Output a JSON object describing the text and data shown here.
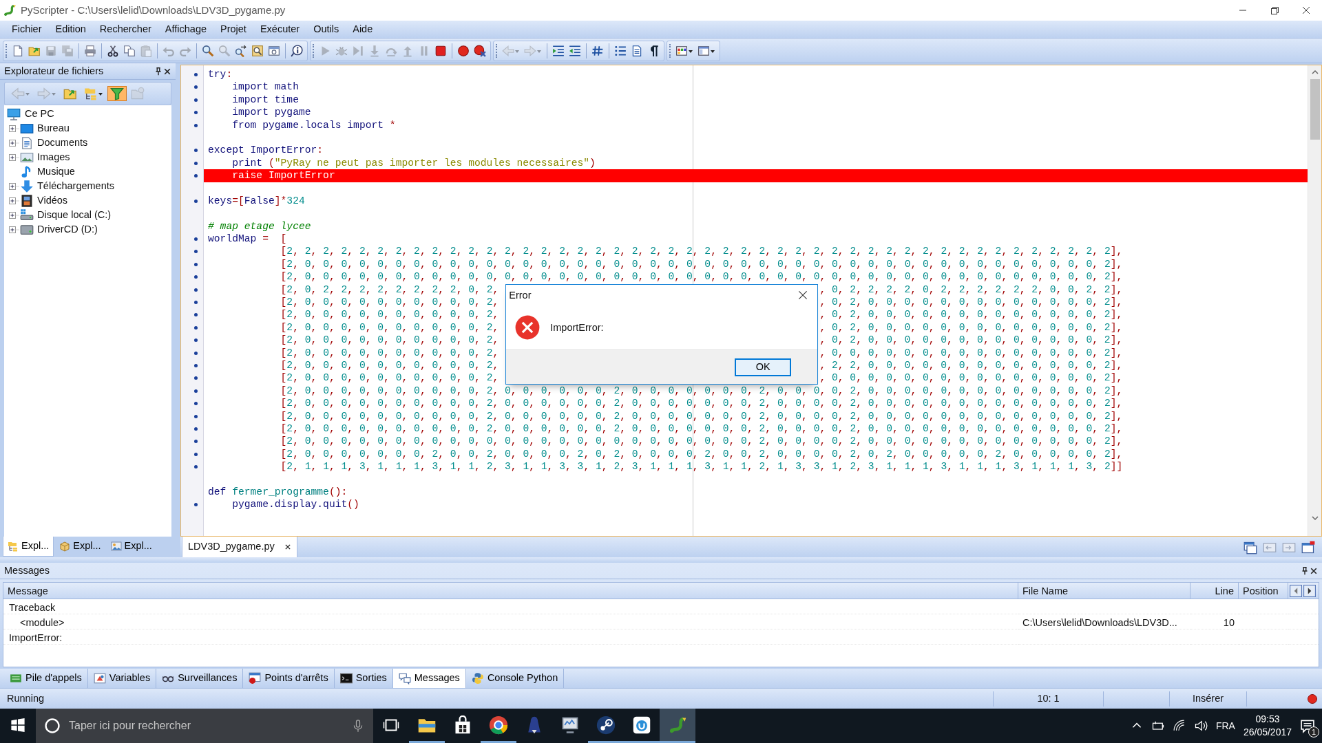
{
  "window": {
    "title": "PyScripter - C:\\Users\\lelid\\Downloads\\LDV3D_pygame.py"
  },
  "menu": [
    "Fichier",
    "Edition",
    "Rechercher",
    "Affichage",
    "Projet",
    "Exécuter",
    "Outils",
    "Aide"
  ],
  "toolbar_groups": [
    [
      {
        "disabled": false
      },
      {
        "disabled": false
      },
      {
        "disabled": true
      },
      {
        "disabled": true
      }
    ],
    [
      {
        "disabled": false
      }
    ],
    [
      {
        "disabled": false
      },
      {
        "disabled": false
      },
      {
        "disabled": true
      }
    ],
    [
      {
        "disabled": true
      },
      {
        "disabled": true
      }
    ],
    [
      {
        "disabled": false
      },
      {
        "disabled": true
      },
      {
        "disabled": false
      },
      {
        "disabled": false
      },
      {
        "disabled": false
      }
    ],
    [
      {
        "disabled": false
      }
    ],
    [
      {
        "disabled": true
      },
      {
        "disabled": true
      },
      {
        "disabled": true
      },
      {
        "disabled": true
      },
      {
        "disabled": true
      },
      {
        "disabled": true
      },
      {
        "disabled": true
      },
      {
        "disabled": false
      }
    ],
    [
      {
        "disabled": false
      },
      {
        "disabled": false
      }
    ],
    [
      {
        "disabled": true
      },
      {
        "disabled": true
      }
    ],
    [
      {
        "disabled": false
      },
      {
        "disabled": false
      }
    ],
    [
      {
        "disabled": false
      }
    ],
    [
      {
        "disabled": false
      },
      {
        "disabled": false
      },
      {
        "disabled": false
      }
    ],
    [
      {
        "disabled": false
      },
      {
        "disabled": false
      }
    ]
  ],
  "file_explorer": {
    "title": "Explorateur de fichiers",
    "toolbar": [
      {
        "disabled": true,
        "on": false
      },
      {
        "disabled": true,
        "on": false
      },
      {
        "disabled": false,
        "on": false
      },
      {
        "disabled": false,
        "on": false
      },
      {
        "disabled": false,
        "on": true
      },
      {
        "disabled": true,
        "on": false
      }
    ],
    "tree": {
      "label": "Ce PC",
      "children": [
        {
          "label": "Bureau",
          "expandable": true
        },
        {
          "label": "Documents",
          "expandable": true
        },
        {
          "label": "Images",
          "expandable": true
        },
        {
          "label": "Musique",
          "expandable": false
        },
        {
          "label": "Téléchargements",
          "expandable": true
        },
        {
          "label": "Vidéos",
          "expandable": true
        },
        {
          "label": "Disque local (C:)",
          "expandable": true
        },
        {
          "label": "DriverCD (D:)",
          "expandable": true
        }
      ]
    },
    "tabs": [
      {
        "label": "Expl...",
        "selected": true
      },
      {
        "label": "Expl...",
        "selected": false
      },
      {
        "label": "Expl...",
        "selected": false
      }
    ]
  },
  "editor": {
    "tabs": [
      {
        "label": "LDV3D_pygame.py",
        "selected": true
      }
    ],
    "lines": [
      {
        "dot": true,
        "tokens": [
          {
            "kind": "id",
            "text": "try"
          },
          {
            "kind": "p",
            "text": ":"
          }
        ]
      },
      {
        "dot": true,
        "tokens": [
          {
            "kind": "id",
            "text": "    import math"
          }
        ]
      },
      {
        "dot": true,
        "tokens": [
          {
            "kind": "id",
            "text": "    import time"
          }
        ]
      },
      {
        "dot": true,
        "tokens": [
          {
            "kind": "id",
            "text": "    import pygame"
          }
        ]
      },
      {
        "dot": true,
        "tokens": [
          {
            "kind": "id",
            "text": "    from pygame.locals import "
          },
          {
            "kind": "p",
            "text": "*"
          }
        ]
      },
      {
        "dot": true,
        "gap_before": true,
        "tokens": [
          {
            "kind": "id",
            "text": "except ImportError"
          },
          {
            "kind": "p",
            "text": ":"
          }
        ]
      },
      {
        "dot": true,
        "tokens": [
          {
            "kind": "id",
            "text": "    print "
          },
          {
            "kind": "p",
            "text": "("
          },
          {
            "kind": "s",
            "text": "\"PyRay ne peut pas importer les modules necessaires\""
          },
          {
            "kind": "p",
            "text": ")"
          }
        ]
      },
      {
        "dot": true,
        "highlighted": true,
        "tokens": [
          {
            "kind": "id",
            "text": "    raise ImportError"
          }
        ]
      },
      {
        "dot": true,
        "gap_before": true,
        "tokens": [
          {
            "kind": "id",
            "text": "keys"
          },
          {
            "kind": "p",
            "text": "=["
          },
          {
            "kind": "id",
            "text": "False"
          },
          {
            "kind": "p",
            "text": "]*"
          },
          {
            "kind": "n",
            "text": "324"
          }
        ]
      },
      {
        "dot": false,
        "gap_before": true,
        "tokens": [
          {
            "kind": "c",
            "text": "# map etage lycee"
          }
        ]
      },
      {
        "dot": true,
        "tokens": [
          {
            "kind": "id",
            "text": "worldMap "
          },
          {
            "kind": "p",
            "text": "=  ["
          }
        ]
      },
      {
        "dot": true,
        "text": "            [2, 2, 2, 2, 2, 2, 2, 2, 2, 2, 2, 2, 2, 2, 2, 2, 2, 2, 2, 2, 2, 2, 2, 2, 2, 2, 2, 2, 2, 2, 2, 2, 2, 2, 2, 2, 2, 2, 2, 2, 2, 2, 2, 2, 2, 2],"
      },
      {
        "dot": true,
        "text": "            [2, 0, 0, 0, 0, 0, 0, 0, 0, 0, 0, 0, 0, 0, 0, 0, 0, 0, 0, 0, 0, 0, 0, 0, 0, 0, 0, 0, 0, 0, 0, 0, 0, 0, 0, 0, 0, 0, 0, 0, 0, 0, 0, 0, 0, 2],"
      },
      {
        "dot": true,
        "text": "            [2, 0, 0, 0, 0, 0, 0, 0, 0, 0, 0, 0, 0, 0, 0, 0, 0, 0, 0, 0, 0, 0, 0, 0, 0, 0, 0, 0, 0, 0, 0, 0, 0, 0, 0, 0, 0, 0, 0, 0, 0, 0, 0, 0, 0, 2],"
      },
      {
        "dot": true,
        "left": "            [2, 0, 2, 2, 2, 2, 2, 2, 2, 2, 0, 2,",
        "right": ", 0, 2, 2, 2, 2, 0, 2, 2, 2, 2, 2, 2, 0, 0, 2, 2],"
      },
      {
        "dot": true,
        "left": "            [2, 0, 0, 0, 0, 0, 0, 0, 0, 0, 0, 2,",
        "right": ", 0, 2, 0, 0, 0, 0, 0, 0, 0, 0, 0, 0, 0, 0, 0, 2],"
      },
      {
        "dot": true,
        "left": "            [2, 0, 0, 0, 0, 0, 0, 0, 0, 0, 0, 2,",
        "right": ", 0, 2, 0, 0, 0, 0, 0, 0, 0, 0, 0, 0, 0, 0, 0, 2],"
      },
      {
        "dot": true,
        "left": "            [2, 0, 0, 0, 0, 0, 0, 0, 0, 0, 0, 2,",
        "right": ", 0, 2, 0, 0, 0, 0, 0, 0, 0, 0, 0, 0, 0, 0, 0, 2],"
      },
      {
        "dot": true,
        "left": "            [2, 0, 0, 0, 0, 0, 0, 0, 0, 0, 0, 2,",
        "right": ", 0, 2, 0, 0, 0, 0, 0, 0, 0, 0, 0, 0, 0, 0, 0, 2],"
      },
      {
        "dot": true,
        "left": "            [2, 0, 0, 0, 0, 0, 0, 0, 0, 0, 0, 2,",
        "right": ", 0, 0, 0, 0, 0, 0, 0, 0, 0, 0, 0, 0, 0, 0, 0, 2],"
      },
      {
        "dot": true,
        "left": "            [2, 0, 0, 0, 0, 0, 0, 0, 0, 0, 0, 2,",
        "right": ", 2, 2, 0, 0, 0, 0, 0, 0, 0, 0, 0, 0, 0, 0, 0, 2],"
      },
      {
        "dot": true,
        "left": "            [2, 0, 0, 0, 0, 0, 0, 0, 0, 0, 0, 2,",
        "right": ", 0, 0, 0, 0, 0, 0, 0, 0, 0, 0, 0, 0, 0, 0, 0, 2],"
      },
      {
        "dot": true,
        "text": "            [2, 0, 0, 0, 0, 0, 0, 0, 0, 0, 0, 2, 0, 0, 0, 0, 0, 0, 2, 0, 0, 0, 0, 0, 0, 0, 2, 0, 0, 0, 0, 2, 0, 0, 0, 0, 0, 0, 0, 0, 0, 0, 0, 0, 0, 2],"
      },
      {
        "dot": true,
        "text": "            [2, 0, 0, 0, 0, 0, 0, 0, 0, 0, 0, 2, 0, 0, 0, 0, 0, 0, 2, 0, 0, 0, 0, 0, 0, 0, 2, 0, 0, 0, 0, 2, 0, 0, 0, 0, 0, 0, 0, 0, 0, 0, 0, 0, 0, 2],"
      },
      {
        "dot": true,
        "text": "            [2, 0, 0, 0, 0, 0, 0, 0, 0, 0, 0, 2, 0, 0, 0, 0, 0, 0, 2, 0, 0, 0, 0, 0, 0, 0, 2, 0, 0, 0, 0, 2, 0, 0, 0, 0, 0, 0, 0, 0, 0, 0, 0, 0, 0, 2],"
      },
      {
        "dot": true,
        "text": "            [2, 0, 0, 0, 0, 0, 0, 0, 0, 0, 0, 2, 0, 0, 0, 0, 0, 0, 2, 0, 0, 0, 0, 0, 0, 0, 2, 0, 0, 0, 0, 2, 0, 0, 0, 0, 0, 0, 0, 0, 0, 0, 0, 0, 0, 2],"
      },
      {
        "dot": true,
        "text": "            [2, 0, 0, 0, 0, 0, 0, 0, 0, 0, 0, 0, 0, 0, 0, 0, 0, 0, 0, 0, 0, 0, 0, 0, 0, 0, 2, 0, 0, 0, 0, 2, 0, 0, 0, 0, 0, 0, 0, 0, 0, 0, 0, 0, 0, 2],"
      },
      {
        "dot": true,
        "text": "            [2, 0, 0, 0, 0, 0, 0, 0, 2, 0, 0, 2, 0, 0, 0, 0, 2, 0, 2, 0, 0, 0, 0, 2, 0, 0, 2, 0, 0, 0, 0, 2, 0, 2, 0, 0, 0, 0, 0, 2, 0, 0, 0, 0, 0, 2],"
      },
      {
        "dot": true,
        "text": "            [2, 1, 1, 1, 3, 1, 1, 1, 3, 1, 1, 2, 3, 1, 1, 3, 3, 1, 2, 3, 1, 1, 1, 3, 1, 1, 2, 1, 3, 3, 1, 2, 3, 1, 1, 1, 3, 1, 1, 1, 3, 1, 1, 1, 3, 2]]"
      },
      {
        "dot": false,
        "gap_before": true,
        "tokens": [
          {
            "kind": "id",
            "text": "def "
          },
          {
            "kind": "f",
            "text": "fermer_programme"
          },
          {
            "kind": "p",
            "text": "():"
          }
        ]
      },
      {
        "dot": true,
        "tokens": [
          {
            "kind": "id",
            "text": "    pygame.display.quit"
          },
          {
            "kind": "p",
            "text": "()"
          }
        ]
      }
    ]
  },
  "dialog": {
    "title": "Error",
    "message": "ImportError:",
    "button": "OK"
  },
  "messages": {
    "title": "Messages",
    "columns": [
      "Message",
      "File Name",
      "Line",
      "Position"
    ],
    "rows": [
      {
        "message": "Traceback",
        "children": [
          {
            "message": "<module>",
            "file_name": "C:\\Users\\lelid\\Downloads\\LDV3D...",
            "line": "10"
          }
        ]
      },
      {
        "message": "ImportError:"
      }
    ]
  },
  "bottom_tabs": [
    {
      "label": "Pile d'appels",
      "selected": false
    },
    {
      "label": "Variables",
      "selected": false
    },
    {
      "label": "Surveillances",
      "selected": false
    },
    {
      "label": "Points d'arrêts",
      "selected": false
    },
    {
      "label": "Sorties",
      "selected": false
    },
    {
      "label": "Messages",
      "selected": true
    },
    {
      "label": "Console Python",
      "selected": false
    }
  ],
  "status_bar": {
    "state": "Running",
    "position": "10: 1",
    "mode": "Insérer"
  },
  "taskbar": {
    "search_placeholder": "Taper ici pour rechercher",
    "apps": [
      {
        "running": true,
        "selected": false
      },
      {
        "running": false,
        "selected": false
      },
      {
        "running": true,
        "selected": false
      },
      {
        "running": false,
        "selected": false
      },
      {
        "running": false,
        "selected": false
      },
      {
        "running": true,
        "selected": false
      },
      {
        "running": true,
        "selected": false
      },
      {
        "running": true,
        "selected": true
      }
    ],
    "language": "FRA",
    "time": "09:53",
    "date": "26/05/2017",
    "notifications": "1"
  }
}
